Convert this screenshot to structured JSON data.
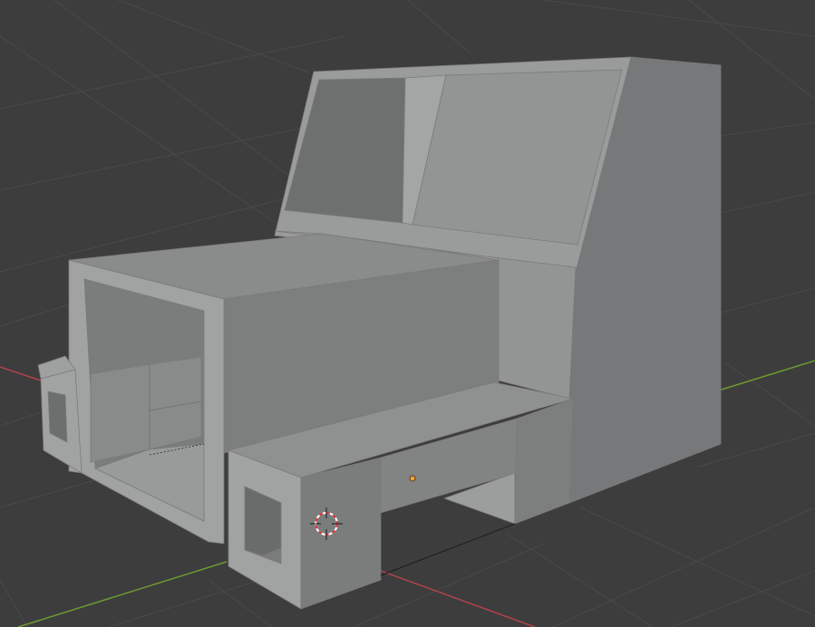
{
  "app": "3D viewport",
  "colors": {
    "background": "#3d3d3d",
    "grid": "#4a4a4a",
    "x_axis": "#b0434c",
    "y_axis": "#6e9932",
    "object_origin": "#f7a12a"
  },
  "scene": {
    "object": "cab-model",
    "cursor": "3d-cursor",
    "origin": "object-origin-dot"
  }
}
